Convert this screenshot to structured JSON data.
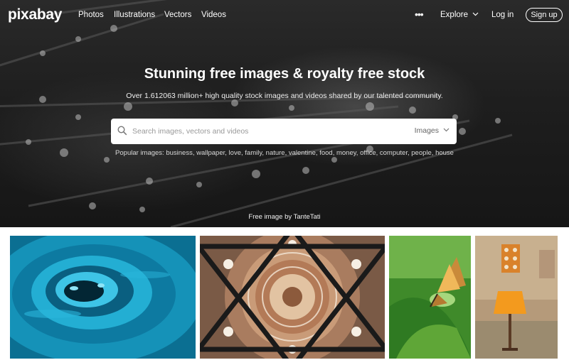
{
  "brand": {
    "logo": "pixabay"
  },
  "nav": {
    "links": [
      "Photos",
      "Illustrations",
      "Vectors",
      "Videos"
    ],
    "more": "•••",
    "explore": "Explore",
    "login": "Log in",
    "signup": "Sign up"
  },
  "hero": {
    "headline": "Stunning free images & royalty free stock",
    "subhead": "Over 1.612063 million+ high quality stock images and videos shared by our talented community.",
    "search": {
      "placeholder": "Search images, vectors and videos",
      "type": "Images"
    },
    "popular_lead": "Popular images:",
    "popular_tags": [
      "business",
      "wallpaper",
      "love",
      "family",
      "nature",
      "valentine",
      "food",
      "money",
      "office",
      "computer",
      "people",
      "house"
    ],
    "credit": "Free image by TanteTati"
  },
  "gallery": {
    "items": [
      "water-drop-ripple",
      "mosque-dome-ceiling",
      "butterfly-on-leaf",
      "orange-lamp-wall"
    ]
  },
  "colors": {
    "hero_bg": "#1e1e1e",
    "text_light": "#ffffff",
    "water": "#1fa3c9",
    "leaf": "#5fa637",
    "lamp": "#f39a1e"
  }
}
